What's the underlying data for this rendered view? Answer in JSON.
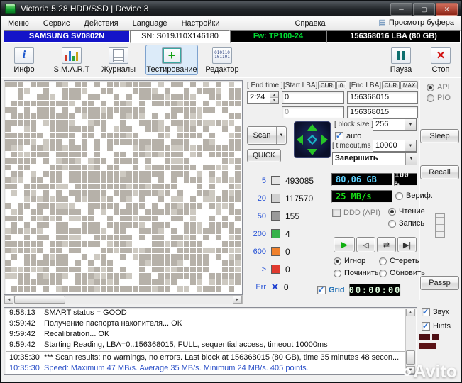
{
  "window": {
    "title": "Victoria 5.28 HDD/SSD | Device 3"
  },
  "icons": {
    "minimize": "─",
    "maximize": "▢",
    "close": "✕",
    "buffer": "▤",
    "combo_arrow": "▼",
    "spin_up": "▲",
    "spin_down": "▼",
    "scroll_left": "◄",
    "scroll_right": "►",
    "scroll_up": "▲",
    "scroll_down": "▼",
    "play": "▶",
    "step_back": "◁",
    "swap": "⇄",
    "skip_end": "▶|",
    "binary": "010110\n101101"
  },
  "menubar": {
    "items": [
      "Меню",
      "Сервис",
      "Действия",
      "Language",
      "Настройки",
      "Справка"
    ],
    "buffer_button": "Просмотр буфера"
  },
  "device_bar": {
    "model": "SAMSUNG SV0802N",
    "serial": "SN: S019J10X146180",
    "firmware": "Fw: TP100-24",
    "capacity": "156368016 LBA (80 GB)"
  },
  "toolbar": {
    "buttons": [
      {
        "label": "Инфо"
      },
      {
        "label": "S.M.A.R.T"
      },
      {
        "label": "Журналы"
      },
      {
        "label": "Тестирование"
      },
      {
        "label": "Редактор"
      }
    ],
    "pause_label": "Пауза",
    "stop_label": "Стоп"
  },
  "test_panel": {
    "end_time_label": "[ End time ]",
    "end_time_value": "2:24",
    "start_lba_label": "[Start LBA]",
    "end_lba_label": "[End LBA]",
    "cur_label": "CUR",
    "zero_label": "0",
    "max_label": "MAX",
    "start_lba": "0",
    "end_lba": "156368015",
    "cur_start": "0",
    "cur_end": "156368015",
    "scan_label": "Scan",
    "quick_label": "QUICK",
    "block_size_label": "[ block size ]",
    "block_size": "256",
    "auto_label": "auto",
    "timeout_label": "[ timeout,ms ]",
    "timeout": "10000",
    "action_value": "Завершить",
    "api_label": "API",
    "pio_label": "PIO",
    "sleep_label": "Sleep",
    "recall_label": "Recall",
    "passp_label": "Passp"
  },
  "stats": {
    "rows": [
      {
        "label": "5",
        "count": "493085",
        "color": "#e4e4e4"
      },
      {
        "label": "20",
        "count": "117570",
        "color": "#d0d0d0"
      },
      {
        "label": "50",
        "count": "155",
        "color": "#9a9a9a"
      },
      {
        "label": "200",
        "count": "4",
        "color": "#36b24a"
      },
      {
        "label": "600",
        "count": "0",
        "color": "#f0812d"
      },
      {
        "label": ">",
        "count": "0",
        "color": "#e03a2f"
      },
      {
        "label": "Err",
        "count": "0",
        "glyph": "✕"
      }
    ]
  },
  "progress": {
    "capacity_display": "80,06 GB",
    "percent_display": "100 %",
    "speed_display": "25 MB/s",
    "verify_label": "Вериф.",
    "ddd_label": "DDD (API)",
    "read_label": "Чтение",
    "write_label": "Запись",
    "ignore_label": "Игнор",
    "erase_label": "Стереть",
    "remap_label": "Починить",
    "refresh_label": "Обновить",
    "grid_label": "Grid",
    "timer_display": "00:00:00"
  },
  "footer": {
    "sound_label": "Звук",
    "hints_label": "Hints"
  },
  "log": {
    "rows": [
      {
        "time": "9:58:13",
        "message": "SMART status = GOOD"
      },
      {
        "time": "9:59:42",
        "message": "Получение паспорта накопителя... ОК"
      },
      {
        "time": "9:59:42",
        "message": "Recalibration... ОК"
      },
      {
        "time": "9:59:42",
        "message": "Starting Reading, LBA=0..156368015, FULL, sequential access, timeout 10000ms"
      },
      {
        "time": "10:35:30",
        "message": "*** Scan results: no warnings, no errors. Last block at 156368015 (80 GB), time 35 minutes 48 secon..."
      },
      {
        "time": "10:35:30",
        "message": "Speed: Maximum 47 MB/s. Average 35 MB/s. Minimum 24 MB/s. 405 points."
      }
    ]
  },
  "watermark": {
    "text": "Avito"
  },
  "scan_grid": {
    "cols": 37,
    "rows": 33,
    "fill_ratio": 0.74,
    "seed": 987654321
  }
}
